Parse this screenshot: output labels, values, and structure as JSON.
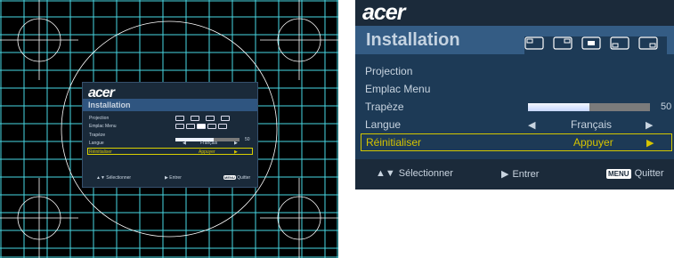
{
  "preview": {
    "brand": "acer",
    "title": "Installation",
    "rows": [
      "Projection",
      "Emplac Menu",
      "Trapèze",
      "Langue",
      "Réinitialiser"
    ],
    "trapeze_value": "50",
    "language_value": "Français",
    "reset_value": "Appuyer",
    "footer": {
      "select": "Sélectionner",
      "enter": "Entrer",
      "menu_key": "MENU",
      "quit": "Quitter"
    }
  },
  "osd": {
    "brand": "acer",
    "title": "Installation",
    "items": [
      {
        "label": "Projection"
      },
      {
        "label": "Emplac Menu"
      },
      {
        "label": "Trapèze",
        "value": "50"
      },
      {
        "label": "Langue",
        "value": "Français"
      },
      {
        "label": "Réinitialiser",
        "value": "Appuyer"
      }
    ],
    "trapeze_level": 0.5,
    "footer": {
      "select": "Sélectionner",
      "enter": "Entrer",
      "menu_key": "MENU",
      "quit": "Quitter"
    },
    "colors": {
      "selected": "#d6c400",
      "title_bg": "#345c84",
      "menu_bg": "#1d3a56",
      "text": "#c8d4e0"
    }
  }
}
